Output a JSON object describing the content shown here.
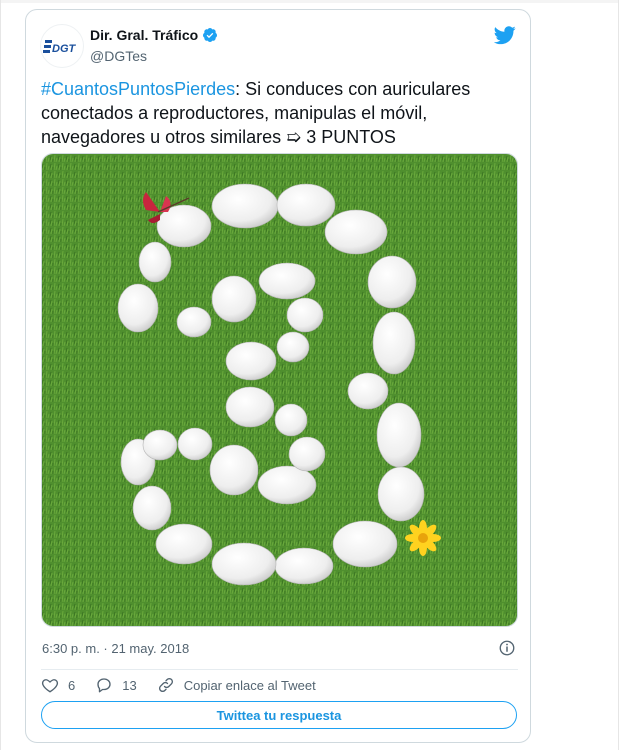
{
  "author": {
    "name": "Dir. Gral. Tráfico",
    "handle": "@DGTes",
    "avatar_text": "DGT",
    "verified": true
  },
  "tweet": {
    "hashtag": "#CuantosPuntosPierdes",
    "text": ": Si conduces con auriculares conectados a reproductores, manipulas el móvil, navegadores u otros similares ➯ 3 PUNTOS"
  },
  "meta": {
    "timestamp": "6:30 p. m. · 21 may. 2018"
  },
  "actions": {
    "likes": "6",
    "replies": "13",
    "copy_link": "Copiar enlace al Tweet"
  },
  "reply_button": "Twittea tu respuesta",
  "colors": {
    "twitter_blue": "#1da1f2",
    "link_blue": "#1b95e0",
    "grass": "#4a8b2c"
  },
  "icons": [
    "twitter-bird-icon",
    "verified-icon",
    "info-icon",
    "heart-icon",
    "reply-icon",
    "link-icon"
  ]
}
